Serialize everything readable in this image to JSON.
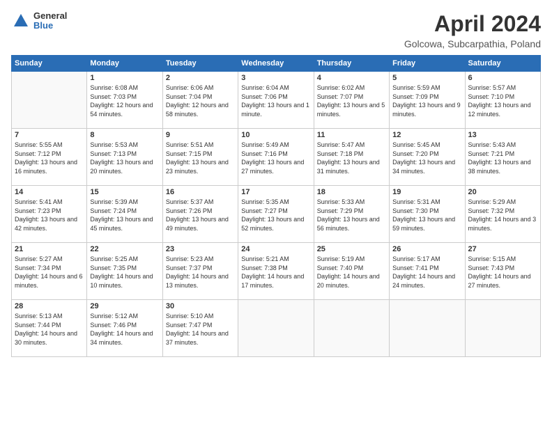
{
  "header": {
    "logo_line1": "General",
    "logo_line2": "Blue",
    "month": "April 2024",
    "location": "Golcowa, Subcarpathia, Poland"
  },
  "weekdays": [
    "Sunday",
    "Monday",
    "Tuesday",
    "Wednesday",
    "Thursday",
    "Friday",
    "Saturday"
  ],
  "weeks": [
    [
      {
        "num": "",
        "empty": true
      },
      {
        "num": "1",
        "sunrise": "6:08 AM",
        "sunset": "7:03 PM",
        "daylight": "12 hours and 54 minutes."
      },
      {
        "num": "2",
        "sunrise": "6:06 AM",
        "sunset": "7:04 PM",
        "daylight": "12 hours and 58 minutes."
      },
      {
        "num": "3",
        "sunrise": "6:04 AM",
        "sunset": "7:06 PM",
        "daylight": "13 hours and 1 minute."
      },
      {
        "num": "4",
        "sunrise": "6:02 AM",
        "sunset": "7:07 PM",
        "daylight": "13 hours and 5 minutes."
      },
      {
        "num": "5",
        "sunrise": "5:59 AM",
        "sunset": "7:09 PM",
        "daylight": "13 hours and 9 minutes."
      },
      {
        "num": "6",
        "sunrise": "5:57 AM",
        "sunset": "7:10 PM",
        "daylight": "13 hours and 12 minutes."
      }
    ],
    [
      {
        "num": "7",
        "sunrise": "5:55 AM",
        "sunset": "7:12 PM",
        "daylight": "13 hours and 16 minutes."
      },
      {
        "num": "8",
        "sunrise": "5:53 AM",
        "sunset": "7:13 PM",
        "daylight": "13 hours and 20 minutes."
      },
      {
        "num": "9",
        "sunrise": "5:51 AM",
        "sunset": "7:15 PM",
        "daylight": "13 hours and 23 minutes."
      },
      {
        "num": "10",
        "sunrise": "5:49 AM",
        "sunset": "7:16 PM",
        "daylight": "13 hours and 27 minutes."
      },
      {
        "num": "11",
        "sunrise": "5:47 AM",
        "sunset": "7:18 PM",
        "daylight": "13 hours and 31 minutes."
      },
      {
        "num": "12",
        "sunrise": "5:45 AM",
        "sunset": "7:20 PM",
        "daylight": "13 hours and 34 minutes."
      },
      {
        "num": "13",
        "sunrise": "5:43 AM",
        "sunset": "7:21 PM",
        "daylight": "13 hours and 38 minutes."
      }
    ],
    [
      {
        "num": "14",
        "sunrise": "5:41 AM",
        "sunset": "7:23 PM",
        "daylight": "13 hours and 42 minutes."
      },
      {
        "num": "15",
        "sunrise": "5:39 AM",
        "sunset": "7:24 PM",
        "daylight": "13 hours and 45 minutes."
      },
      {
        "num": "16",
        "sunrise": "5:37 AM",
        "sunset": "7:26 PM",
        "daylight": "13 hours and 49 minutes."
      },
      {
        "num": "17",
        "sunrise": "5:35 AM",
        "sunset": "7:27 PM",
        "daylight": "13 hours and 52 minutes."
      },
      {
        "num": "18",
        "sunrise": "5:33 AM",
        "sunset": "7:29 PM",
        "daylight": "13 hours and 56 minutes."
      },
      {
        "num": "19",
        "sunrise": "5:31 AM",
        "sunset": "7:30 PM",
        "daylight": "13 hours and 59 minutes."
      },
      {
        "num": "20",
        "sunrise": "5:29 AM",
        "sunset": "7:32 PM",
        "daylight": "14 hours and 3 minutes."
      }
    ],
    [
      {
        "num": "21",
        "sunrise": "5:27 AM",
        "sunset": "7:34 PM",
        "daylight": "14 hours and 6 minutes."
      },
      {
        "num": "22",
        "sunrise": "5:25 AM",
        "sunset": "7:35 PM",
        "daylight": "14 hours and 10 minutes."
      },
      {
        "num": "23",
        "sunrise": "5:23 AM",
        "sunset": "7:37 PM",
        "daylight": "14 hours and 13 minutes."
      },
      {
        "num": "24",
        "sunrise": "5:21 AM",
        "sunset": "7:38 PM",
        "daylight": "14 hours and 17 minutes."
      },
      {
        "num": "25",
        "sunrise": "5:19 AM",
        "sunset": "7:40 PM",
        "daylight": "14 hours and 20 minutes."
      },
      {
        "num": "26",
        "sunrise": "5:17 AM",
        "sunset": "7:41 PM",
        "daylight": "14 hours and 24 minutes."
      },
      {
        "num": "27",
        "sunrise": "5:15 AM",
        "sunset": "7:43 PM",
        "daylight": "14 hours and 27 minutes."
      }
    ],
    [
      {
        "num": "28",
        "sunrise": "5:13 AM",
        "sunset": "7:44 PM",
        "daylight": "14 hours and 30 minutes."
      },
      {
        "num": "29",
        "sunrise": "5:12 AM",
        "sunset": "7:46 PM",
        "daylight": "14 hours and 34 minutes."
      },
      {
        "num": "30",
        "sunrise": "5:10 AM",
        "sunset": "7:47 PM",
        "daylight": "14 hours and 37 minutes."
      },
      {
        "num": "",
        "empty": true
      },
      {
        "num": "",
        "empty": true
      },
      {
        "num": "",
        "empty": true
      },
      {
        "num": "",
        "empty": true
      }
    ]
  ]
}
